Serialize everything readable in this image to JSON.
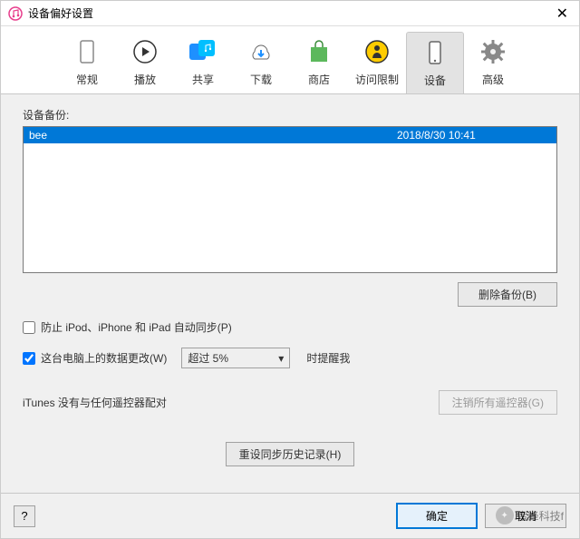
{
  "window": {
    "title": "设备偏好设置"
  },
  "tabs": [
    {
      "label": "常规"
    },
    {
      "label": "播放"
    },
    {
      "label": "共享"
    },
    {
      "label": "下载"
    },
    {
      "label": "商店"
    },
    {
      "label": "访问限制"
    },
    {
      "label": "设备"
    },
    {
      "label": "高级"
    }
  ],
  "backup": {
    "label": "设备备份:",
    "rows": [
      {
        "name": "bee",
        "date": "2018/8/30 10:41"
      }
    ],
    "delete_button": "删除备份(B)"
  },
  "options": {
    "prevent_sync": "防止 iPod、iPhone 和 iPad 自动同步(P)",
    "warn_label": "这台电脑上的数据更改(W)",
    "warn_select_value": "超过 5%",
    "warn_suffix": "时提醒我"
  },
  "pairing": {
    "status": "iTunes 没有与任何遥控器配对",
    "button": "注销所有遥控器(G)"
  },
  "reset_button": "重设同步历史记录(H)",
  "footer": {
    "help": "?",
    "ok": "确定",
    "cancel": "取消"
  },
  "watermark": "蜜蜂科技f"
}
